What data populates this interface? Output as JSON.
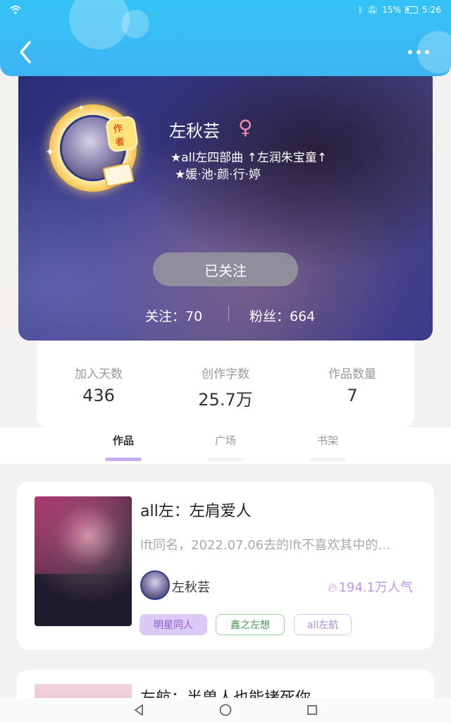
{
  "status": {
    "battery": "15%",
    "time": "5:26"
  },
  "profile": {
    "badge": "作者",
    "name": "左秋芸",
    "gender_symbol": "♀",
    "bio_line1": "★all左四部曲 ↑左润朱宝童↑",
    "bio_line2": "★媛·池·颜·行·婷",
    "follow_button": "已关注",
    "following": "关注：70",
    "fans": "粉丝：664"
  },
  "metrics": [
    {
      "label": "加入天数",
      "value": "436"
    },
    {
      "label": "创作字数",
      "value": "25.7万"
    },
    {
      "label": "作品数量",
      "value": "7"
    }
  ],
  "tabs": [
    {
      "label": "作品",
      "active": true
    },
    {
      "label": "广场",
      "active": false
    },
    {
      "label": "书架",
      "active": false
    }
  ],
  "books": [
    {
      "title": "all左：左肩爱人",
      "description": "lft同名，2022.07.06去的lft不喜欢其中的…",
      "author": "左秋芸",
      "popularity": "194.1万人气",
      "tags": [
        "明星同人",
        "鑫之左想",
        "all左航"
      ]
    },
    {
      "title": "左航：半兽人也能拷死你"
    }
  ],
  "colors": {
    "header": "#3eb4f3",
    "accent": "#c7aef1",
    "popularity": "#b996f0"
  },
  "icons": [
    "wifi-icon",
    "bluetooth-icon",
    "mute-icon",
    "battery-icon",
    "back-icon",
    "more-icon",
    "flame-icon",
    "nav-back-icon",
    "nav-home-icon",
    "nav-recents-icon"
  ]
}
